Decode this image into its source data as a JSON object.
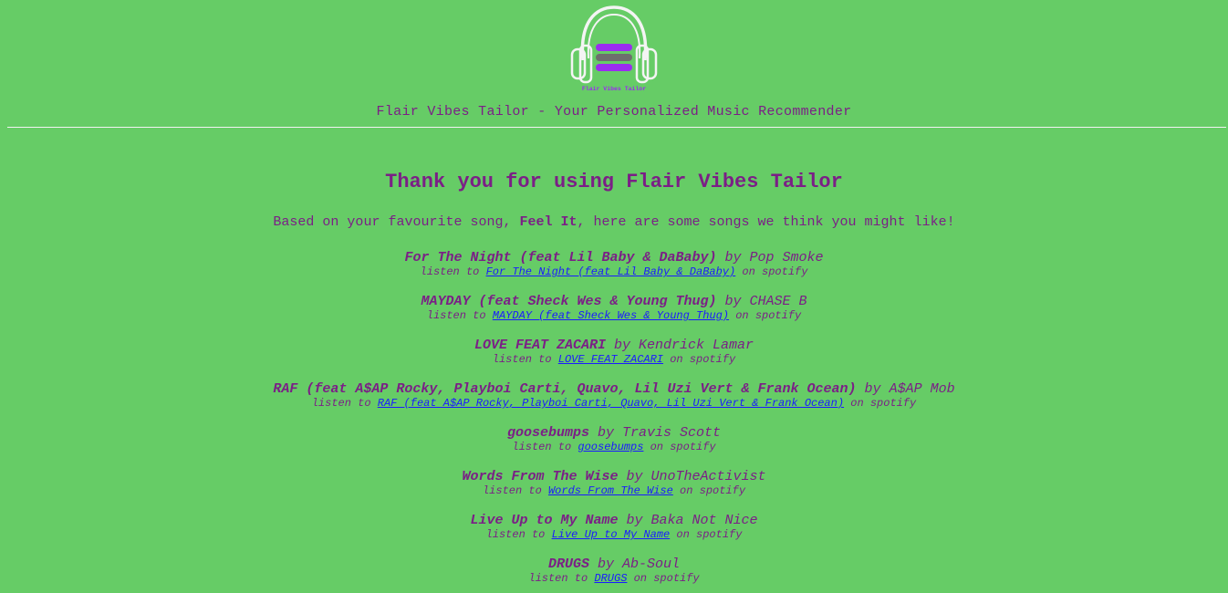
{
  "brand": {
    "logo_text": "Flair Vibes Tailor",
    "tagline": "Flair Vibes Tailor - Your Personalized Music Recommender",
    "colors": {
      "background": "#66cc66",
      "text": "#7b1f86",
      "link": "#1a1aff",
      "logo_bar_top": "#9b2cf0",
      "logo_bar_mid": "#6e6e6e",
      "logo_bar_bottom": "#9b2cf0"
    }
  },
  "main": {
    "heading": "Thank you for using Flair Vibes Tailor",
    "intro_prefix": "Based on your favourite song,",
    "favourite_song": "Feel It",
    "intro_suffix": ", here are some songs we think you might like!"
  },
  "labels": {
    "by": "by",
    "listen_to": "listen to",
    "on_spotify": "on spotify"
  },
  "songs": [
    {
      "title": "For The Night (feat Lil Baby & DaBaby)",
      "artist": "Pop Smoke"
    },
    {
      "title": "MAYDAY (feat Sheck Wes & Young Thug)",
      "artist": "CHASE B"
    },
    {
      "title": "LOVE FEAT ZACARI",
      "artist": "Kendrick Lamar"
    },
    {
      "title": "RAF (feat A$AP Rocky, Playboi Carti, Quavo, Lil Uzi Vert & Frank Ocean)",
      "artist": "A$AP Mob"
    },
    {
      "title": "goosebumps",
      "artist": "Travis Scott"
    },
    {
      "title": "Words From The Wise",
      "artist": "UnoTheActivist"
    },
    {
      "title": "Live Up to My Name",
      "artist": "Baka Not Nice"
    },
    {
      "title": "DRUGS",
      "artist": "Ab-Soul"
    }
  ]
}
